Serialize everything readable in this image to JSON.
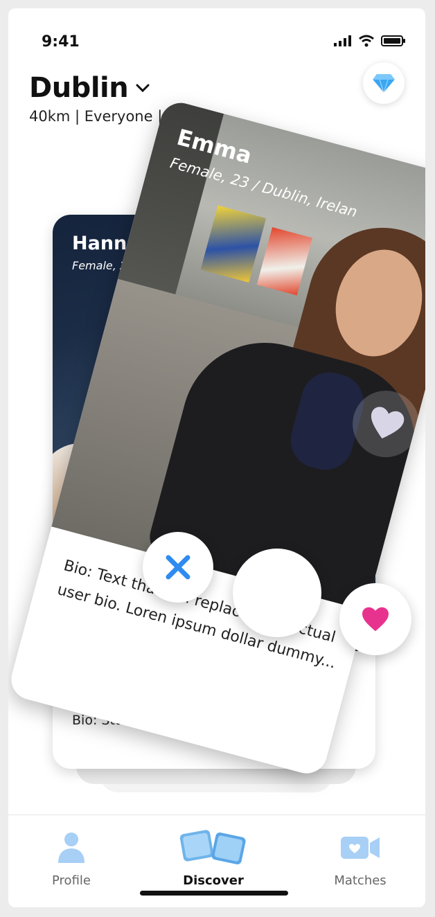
{
  "status_bar": {
    "time": "9:41",
    "icons": [
      "signal-icon",
      "wifi-icon",
      "battery-icon"
    ]
  },
  "header": {
    "city": "Dublin",
    "filters": "40km | Everyone | 18 t",
    "premium_icon": "diamond-icon"
  },
  "cards": {
    "back": {
      "name": "Hanna",
      "subtitle": "Female, 23 / S",
      "bio": "Bio: Studying law at T.U.s 📚"
    },
    "front": {
      "name": "Emma",
      "subtitle": "Female, 23 / Dublin, Irelan",
      "bio": "Bio: Text that will replace with actual user bio. Loren ipsum dollar dummy..."
    }
  },
  "actions": {
    "dislike_icon": "close-icon",
    "like_icon": "heart-icon"
  },
  "tabbar": {
    "tabs": [
      {
        "label": "Profile",
        "icon": "user-icon",
        "active": false
      },
      {
        "label": "Discover",
        "icon": "cards-icon",
        "active": true
      },
      {
        "label": "Matches",
        "icon": "video-icon",
        "active": false
      }
    ]
  },
  "colors": {
    "accent_blue": "#2f8bf0",
    "like_pink": "#e8338e",
    "gem_blue": "#3aa7f2",
    "tab_icon_blue": "#9fc8f2"
  }
}
